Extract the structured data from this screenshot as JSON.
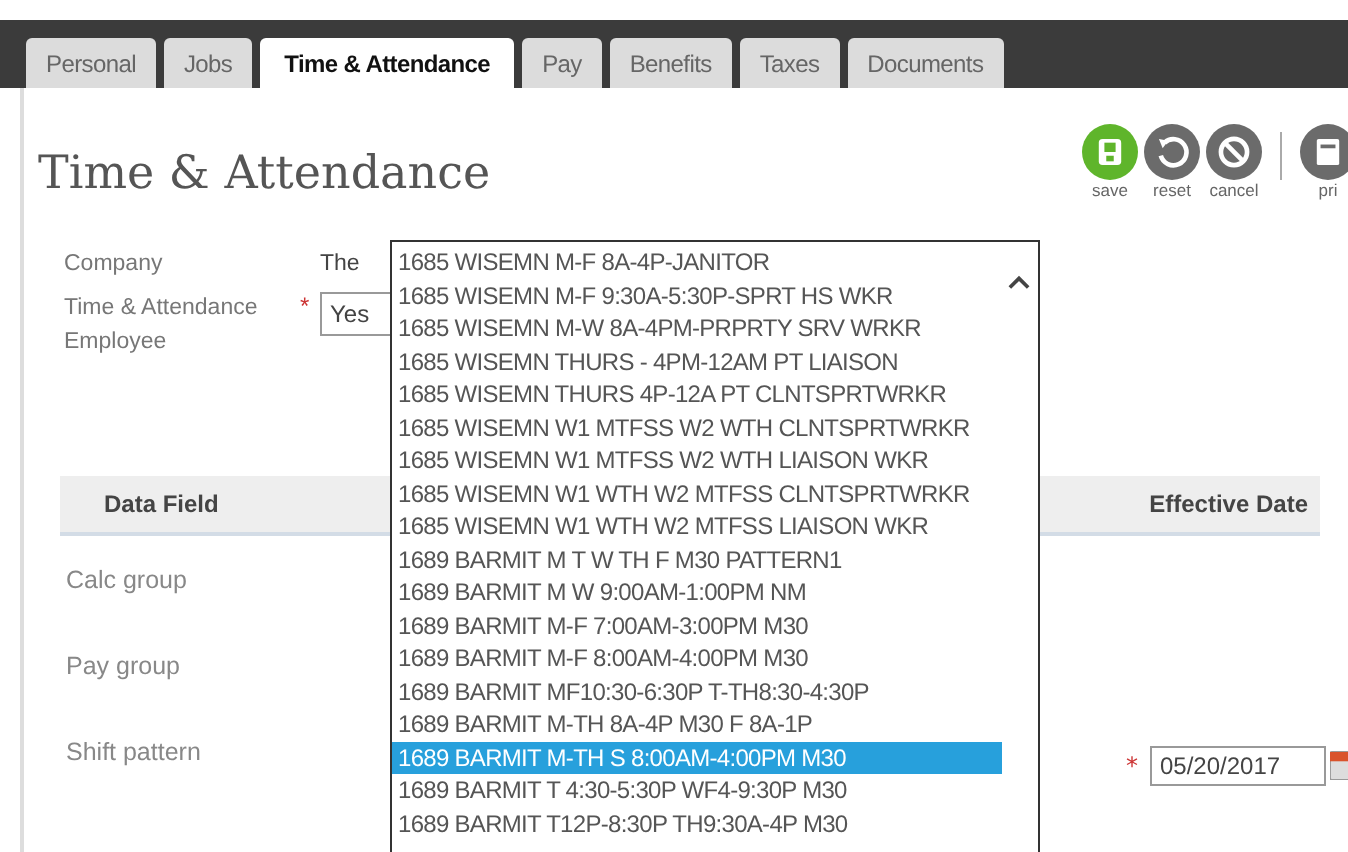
{
  "tabs": [
    {
      "label": "Personal",
      "selected": false
    },
    {
      "label": "Jobs",
      "selected": false
    },
    {
      "label": "Time & Attendance",
      "selected": true
    },
    {
      "label": "Pay",
      "selected": false
    },
    {
      "label": "Benefits",
      "selected": false
    },
    {
      "label": "Taxes",
      "selected": false
    },
    {
      "label": "Documents",
      "selected": false
    }
  ],
  "title": "Time & Attendance",
  "actions": [
    {
      "kind": "save",
      "label": "save"
    },
    {
      "kind": "reset",
      "label": "reset"
    },
    {
      "kind": "cancel",
      "label": "cancel"
    },
    {
      "kind": "print",
      "label": "pri"
    }
  ],
  "form": {
    "company": {
      "label": "Company",
      "value": "The"
    },
    "employee": {
      "label": "Time & Attendance Employee",
      "required": true,
      "required_mark": "*",
      "value": "Yes"
    }
  },
  "table": {
    "columns": [
      "Data Field",
      "Effective Date"
    ],
    "rows": [
      {
        "label": "Calc group"
      },
      {
        "label": "Pay group"
      },
      {
        "label": "Shift pattern",
        "required": true,
        "required_mark": "*",
        "date": "05/20/2017"
      }
    ]
  },
  "dropdown": {
    "options": [
      {
        "label": "1685 WISEMN M-F 8A-4P-JANITOR",
        "selected": false
      },
      {
        "label": "1685 WISEMN M-F 9:30A-5:30P-SPRT HS WKR",
        "selected": false
      },
      {
        "label": "1685 WISEMN M-W 8A-4PM-PRPRTY SRV WRKR",
        "selected": false
      },
      {
        "label": "1685 WISEMN THURS - 4PM-12AM PT LIAISON",
        "selected": false
      },
      {
        "label": "1685 WISEMN THURS 4P-12A PT CLNTSPRTWRKR",
        "selected": false
      },
      {
        "label": "1685 WISEMN W1 MTFSS W2 WTH CLNTSPRTWRKR",
        "selected": false
      },
      {
        "label": "1685 WISEMN W1 MTFSS W2 WTH LIAISON WKR",
        "selected": false
      },
      {
        "label": "1685 WISEMN W1 WTH W2 MTFSS CLNTSPRTWRKR",
        "selected": false
      },
      {
        "label": "1685 WISEMN W1 WTH W2 MTFSS LIAISON WKR",
        "selected": false
      },
      {
        "label": "1689 BARMIT M T W TH F M30 PATTERN1",
        "selected": false
      },
      {
        "label": "1689 BARMIT M W 9:00AM-1:00PM NM",
        "selected": false
      },
      {
        "label": "1689 BARMIT M-F 7:00AM-3:00PM M30",
        "selected": false
      },
      {
        "label": "1689 BARMIT M-F 8:00AM-4:00PM M30",
        "selected": false
      },
      {
        "label": "1689 BARMIT MF10:30-6:30P T-TH8:30-4:30P",
        "selected": false
      },
      {
        "label": "1689 BARMIT M-TH 8A-4P M30 F 8A-1P",
        "selected": false
      },
      {
        "label": "1689 BARMIT M-TH S 8:00AM-4:00PM M30",
        "selected": true
      },
      {
        "label": "1689 BARMIT T 4:30-5:30P WF4-9:30P M30",
        "selected": false
      },
      {
        "label": "1689 BARMIT T12P-8:30P TH9:30A-4P M30",
        "selected": false
      }
    ]
  }
}
